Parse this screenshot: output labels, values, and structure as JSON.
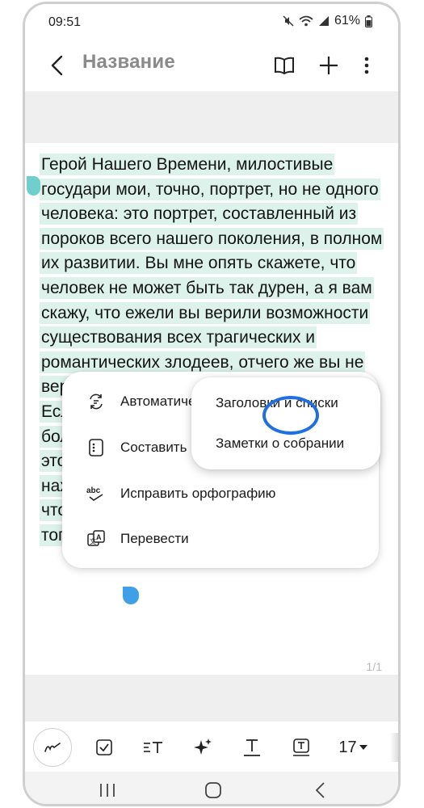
{
  "status_bar": {
    "time": "09:51",
    "battery": "61%",
    "icons": [
      "mute-icon",
      "wifi-icon",
      "signal-icon",
      "battery-icon"
    ]
  },
  "app_bar": {
    "title": "Название",
    "icons": [
      "back-arrow-icon",
      "book-icon",
      "plus-icon",
      "more-vertical-icon"
    ]
  },
  "note": {
    "text": "Герой Нашего Времени, милостивые государи мои, точно, портрет, но не одного человека: это портрет, составленный из пороков всего нашего поколения, в полном их развитии. Вы мне опять скажете, что человек не может быть так дурен, а я вам скажу, что ежели вы верили возможности существования всех трагических и романтических злодеев, отчего же вы не веруете в действительность Печорина? Если вы любовались вымыслами гораздо более ужасными и уродливыми, отчего же этот характер, даже как вымысел, не находит у вас пощады? Уж не оттого ли, что в нем больше правды, нежели бы вы того желали?..",
    "page_indicator": "1/1",
    "highlight_color": "#dcf2ea"
  },
  "context_menu": {
    "items": [
      {
        "label": "Автоматическое форматирование",
        "icon": "auto-format-icon"
      },
      {
        "label": "Составить",
        "icon": "compose-icon"
      },
      {
        "label": "Исправить орфографию",
        "icon": "spellcheck-icon"
      },
      {
        "label": "Перевести",
        "icon": "translate-icon"
      }
    ],
    "submenu": [
      {
        "label": "Заголовки и списки"
      },
      {
        "label": "Заметки о собрании"
      }
    ],
    "tap_color": "#1f6fe0"
  },
  "toolbar": {
    "font_size": "17",
    "icons": [
      "pen-icon",
      "checkbox-icon",
      "text-style-icon",
      "ai-sparkle-icon",
      "text-underline-icon",
      "text-box-icon",
      "font-size-dropdown-icon"
    ]
  },
  "nav_bar": {
    "icons": [
      "recents-icon",
      "home-icon",
      "back-icon"
    ]
  }
}
